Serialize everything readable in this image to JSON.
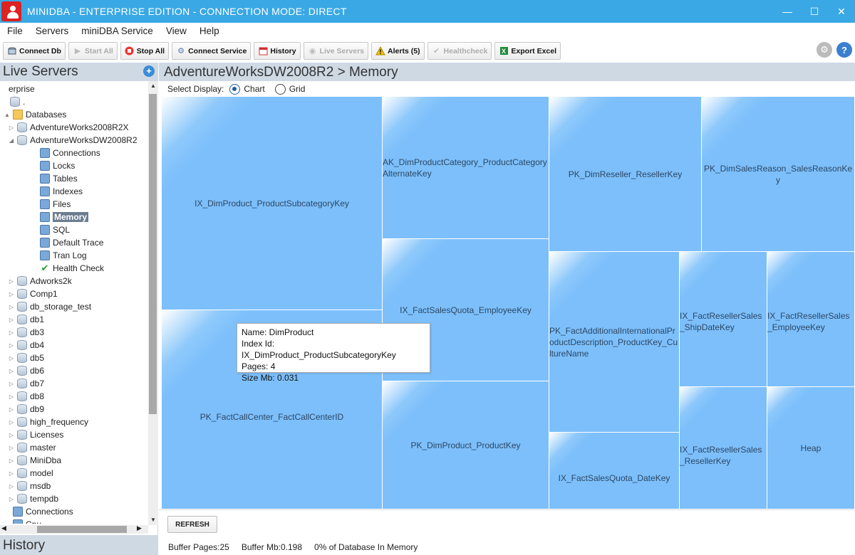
{
  "window": {
    "title": "MINIDBA - ENTERPRISE EDITION - CONNECTION MODE: DIRECT",
    "minimize": "—",
    "maximize": "☐",
    "close": "✕"
  },
  "menu": [
    "File",
    "Servers",
    "miniDBA Service",
    "View",
    "Help"
  ],
  "toolbar": {
    "connect_db": "Connect Db",
    "start_all": "Start All",
    "stop_all": "Stop All",
    "connect_service": "Connect Service",
    "history": "History",
    "live_servers": "Live Servers",
    "alerts": "Alerts (5)",
    "healthcheck": "Healthcheck",
    "export_excel": "Export Excel"
  },
  "left": {
    "title": "Live Servers",
    "history_title": "History",
    "tree": [
      {
        "label": "erprise",
        "icon": "none",
        "exp": ""
      },
      {
        "label": ".",
        "icon": "server",
        "exp": ""
      },
      {
        "label": "Databases",
        "icon": "folder",
        "exp": "▲"
      },
      {
        "label": "AdventureWorks2008R2X",
        "icon": "db",
        "exp": "▷"
      },
      {
        "label": "AdventureWorksDW2008R2",
        "icon": "db",
        "exp": "◢"
      },
      {
        "label": "Connections",
        "icon": "connections",
        "exp": ""
      },
      {
        "label": "Locks",
        "icon": "lock",
        "exp": ""
      },
      {
        "label": "Tables",
        "icon": "table",
        "exp": ""
      },
      {
        "label": "Indexes",
        "icon": "index",
        "exp": ""
      },
      {
        "label": "Files",
        "icon": "file",
        "exp": ""
      },
      {
        "label": "Memory",
        "icon": "memory",
        "exp": "",
        "selected": true
      },
      {
        "label": "SQL",
        "icon": "sql",
        "exp": ""
      },
      {
        "label": "Default Trace",
        "icon": "trace",
        "exp": ""
      },
      {
        "label": "Tran Log",
        "icon": "log",
        "exp": ""
      },
      {
        "label": "Health Check",
        "icon": "check",
        "exp": ""
      },
      {
        "label": "Adworks2k",
        "icon": "db",
        "exp": "▷"
      },
      {
        "label": "Comp1",
        "icon": "db",
        "exp": "▷"
      },
      {
        "label": "db_storage_test",
        "icon": "db",
        "exp": "▷"
      },
      {
        "label": "db1",
        "icon": "db",
        "exp": "▷"
      },
      {
        "label": "db3",
        "icon": "db",
        "exp": "▷"
      },
      {
        "label": "db4",
        "icon": "db",
        "exp": "▷"
      },
      {
        "label": "db5",
        "icon": "db",
        "exp": "▷"
      },
      {
        "label": "db6",
        "icon": "db",
        "exp": "▷"
      },
      {
        "label": "db7",
        "icon": "db",
        "exp": "▷"
      },
      {
        "label": "db8",
        "icon": "db",
        "exp": "▷"
      },
      {
        "label": "db9",
        "icon": "db",
        "exp": "▷"
      },
      {
        "label": "high_frequency",
        "icon": "db",
        "exp": "▷"
      },
      {
        "label": "Licenses",
        "icon": "db",
        "exp": "▷"
      },
      {
        "label": "master",
        "icon": "db",
        "exp": "▷"
      },
      {
        "label": "MiniDba",
        "icon": "db",
        "exp": "▷"
      },
      {
        "label": "model",
        "icon": "db",
        "exp": "▷"
      },
      {
        "label": "msdb",
        "icon": "db",
        "exp": "▷"
      },
      {
        "label": "tempdb",
        "icon": "db",
        "exp": "▷"
      },
      {
        "label": "Connections",
        "icon": "connections",
        "exp": ""
      },
      {
        "label": "Cpu",
        "icon": "cpu",
        "exp": ""
      }
    ]
  },
  "main": {
    "title": "AdventureWorksDW2008R2 > Memory",
    "select_display": "Select Display:",
    "chart_option": "Chart",
    "grid_option": "Grid",
    "selected_option": "Chart",
    "refresh": "REFRESH",
    "status": {
      "buffer_pages": "Buffer Pages:25",
      "buffer_mb": "Buffer Mb:0.198",
      "percent": "0% of Database In Memory"
    }
  },
  "treemap": [
    {
      "label": "IX_DimProduct_ProductSubcategoryKey"
    },
    {
      "label": "PK_FactCallCenter_FactCallCenterID"
    },
    {
      "label": "AK_DimProductCategory_ProductCategoryAlternateKey"
    },
    {
      "label": "IX_FactSalesQuota_EmployeeKey"
    },
    {
      "label": "PK_DimProduct_ProductKey"
    },
    {
      "label": "PK_DimReseller_ResellerKey"
    },
    {
      "label": "PK_DimSalesReason_SalesReasonKey"
    },
    {
      "label": "PK_FactAdditionalInternationalProductDescription_ProductKey_CultureName"
    },
    {
      "label": "IX_FactSalesQuota_DateKey"
    },
    {
      "label": "IX_FactResellerSales_ShipDateKey"
    },
    {
      "label": "IX_FactResellerSales_EmployeeKey"
    },
    {
      "label": "IX_FactResellerSales_ResellerKey"
    },
    {
      "label": "Heap"
    }
  ],
  "tooltip": {
    "name": "Name: DimProduct",
    "index_id": "Index Id: IX_DimProduct_ProductSubcategoryKey",
    "pages": "Pages: 4",
    "size": "Size Mb: 0.031"
  }
}
